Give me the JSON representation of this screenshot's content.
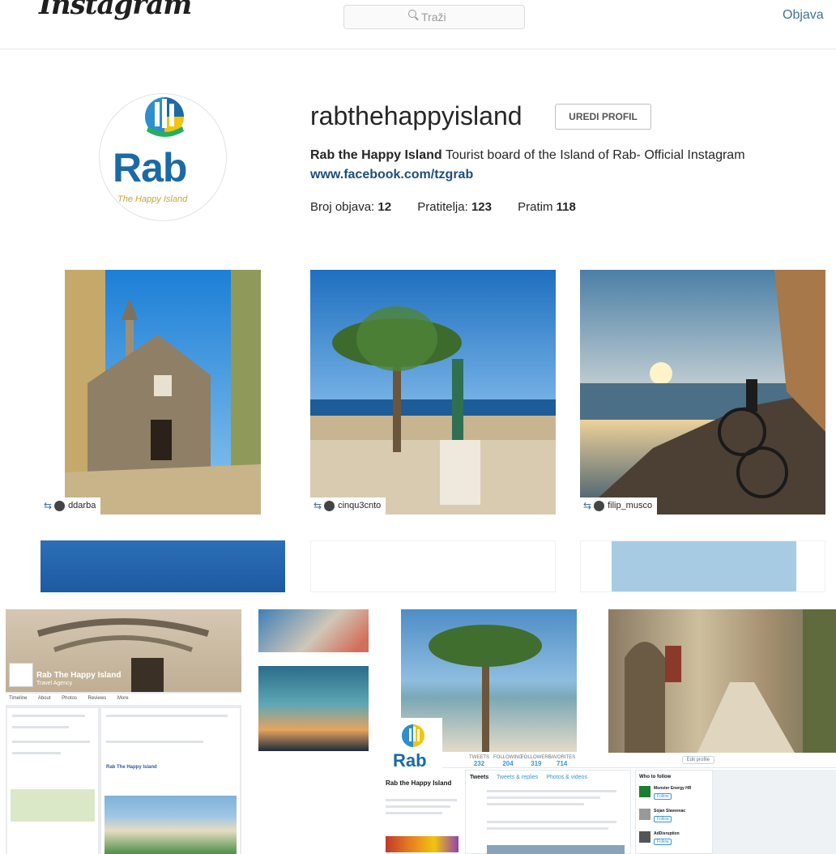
{
  "instagram": {
    "logo": "Instagram",
    "search_placeholder": "Traži",
    "upload_label": "Objava"
  },
  "profile": {
    "username": "rabthehappyisland",
    "edit_button": "UREDI PROFIL",
    "full_name": "Rab the Happy Island",
    "bio": "Tourist board of the Island of Rab- Official Instagram",
    "website": "www.facebook.com/tzgrab",
    "logo_text": "Rab",
    "logo_subtext": "The Happy Island",
    "stats": {
      "posts_label": "Broj objava:",
      "posts": "12",
      "followers_label": "Pratitelja:",
      "followers": "123",
      "following_label": "Pratim",
      "following": "118"
    }
  },
  "posts": [
    {
      "user": "ddarba"
    },
    {
      "user": "cinqu3cnto"
    },
    {
      "user": "filip_musco"
    }
  ],
  "facebook": {
    "page_name": "Rab The Happy Island",
    "page_type": "Travel Agency",
    "nav": [
      "Timeline",
      "About",
      "Photos",
      "Reviews",
      "More"
    ],
    "post_title": "Rab The Happy Island"
  },
  "twitter": {
    "name": "Rab the Happy Island",
    "logo_text": "Rab",
    "stats": [
      {
        "label": "TWEETS",
        "value": "232"
      },
      {
        "label": "FOLLOWING",
        "value": "204"
      },
      {
        "label": "FOLLOWERS",
        "value": "319"
      },
      {
        "label": "FAVORITES",
        "value": "714"
      }
    ],
    "edit_label": "Edit profile",
    "tabs": [
      "Tweets",
      "Tweets & replies",
      "Photos & videos"
    ],
    "who_to_follow": "Who to follow",
    "suggestions": [
      {
        "name": "Monster Energy HR",
        "action": "Follow"
      },
      {
        "name": "Sojan Slaveevac",
        "action": "Follow"
      },
      {
        "name": "AdDisruption",
        "action": "Follow"
      }
    ]
  }
}
